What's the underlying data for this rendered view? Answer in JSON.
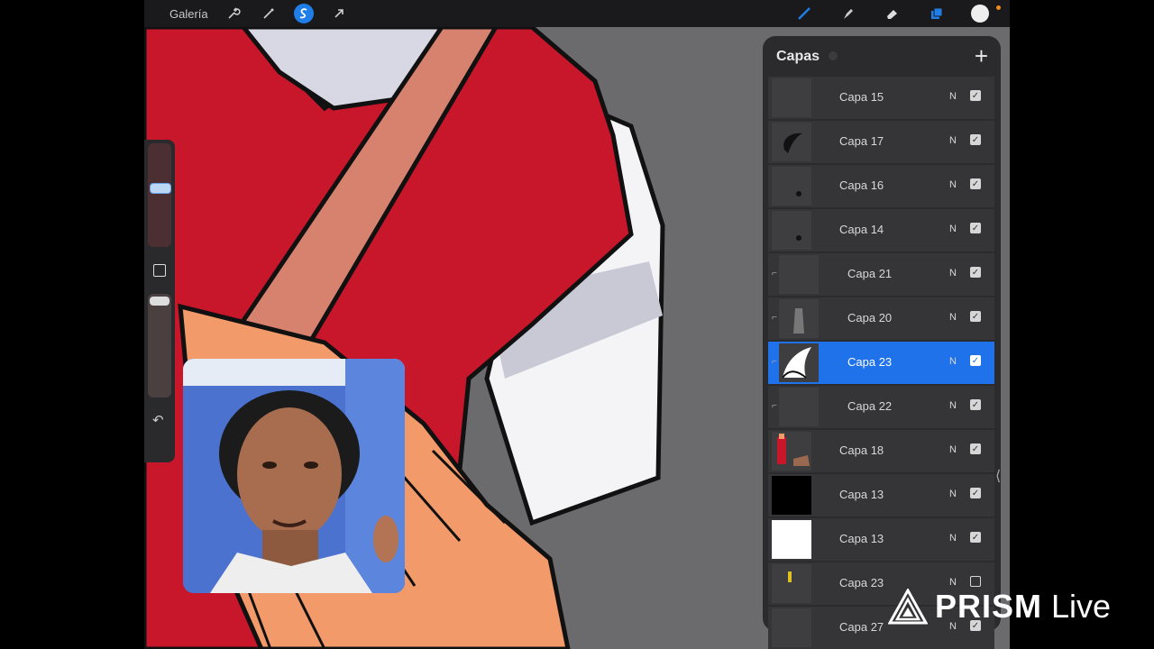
{
  "toolbar": {
    "gallery_label": "Galería",
    "left_icons": [
      "wrench-icon",
      "magic-wand-icon",
      "selection-icon",
      "transform-arrow-icon"
    ],
    "right_icons": [
      "brush-icon",
      "smudge-icon",
      "eraser-icon",
      "layers-icon"
    ],
    "accent_color": "#1f7ee8"
  },
  "layers_panel": {
    "title": "Capas",
    "add_label": "+",
    "selected_color": "#1f72ea",
    "layers": [
      {
        "name": "Capa 15",
        "mode": "N",
        "visible": true
      },
      {
        "name": "Capa 17",
        "mode": "N",
        "visible": true
      },
      {
        "name": "Capa 16",
        "mode": "N",
        "visible": true
      },
      {
        "name": "Capa 14",
        "mode": "N",
        "visible": true
      },
      {
        "name": "Capa 21",
        "mode": "N",
        "visible": true
      },
      {
        "name": "Capa 20",
        "mode": "N",
        "visible": true
      },
      {
        "name": "Capa 23",
        "mode": "N",
        "visible": true,
        "selected": true
      },
      {
        "name": "Capa 22",
        "mode": "N",
        "visible": true
      },
      {
        "name": "Capa 18",
        "mode": "N",
        "visible": true
      },
      {
        "name": "Capa 13",
        "mode": "N",
        "visible": true
      },
      {
        "name": "Capa 13",
        "mode": "N",
        "visible": true
      },
      {
        "name": "Capa 23",
        "mode": "N",
        "visible": false
      },
      {
        "name": "Capa 27",
        "mode": "N",
        "visible": true
      }
    ]
  },
  "watermark": {
    "brand": "PRISM",
    "suffix": "Live"
  }
}
